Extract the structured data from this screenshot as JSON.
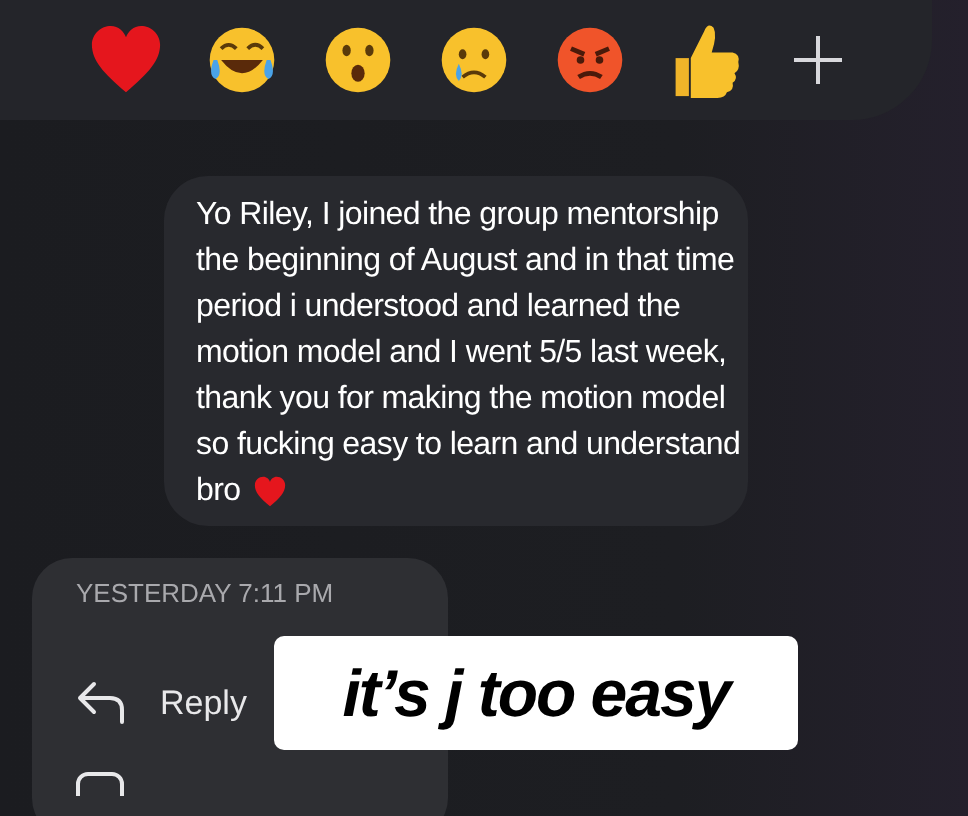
{
  "message": {
    "lines": [
      "Yo Riley, I joined the group mentorship",
      "the beginning of August and in that time",
      "period i understood and learned the",
      "motion model and I went 5/5 last week,",
      "thank you for making the motion model",
      "so fucking easy to learn and understand",
      "bro"
    ]
  },
  "menu": {
    "timestamp": "YESTERDAY 7:11 PM",
    "items": [
      {
        "label": "Reply"
      }
    ]
  },
  "sticker": {
    "text": "it’s j too easy"
  }
}
